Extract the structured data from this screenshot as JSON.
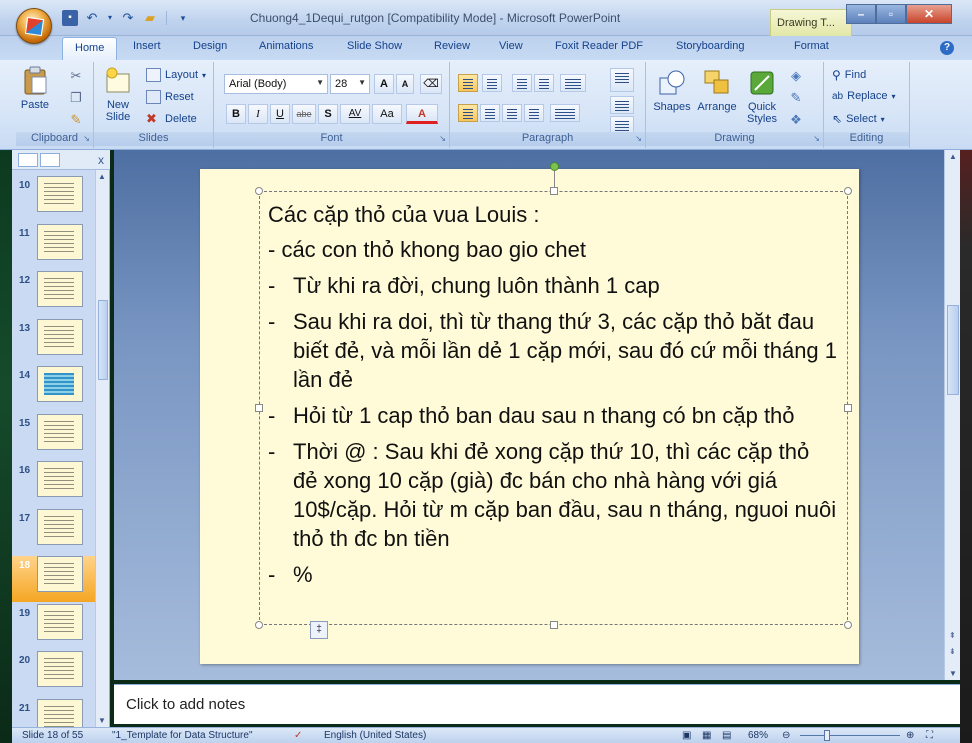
{
  "app": {
    "doc_title": "Chuong4_1Dequi_rutgon [Compatibility Mode] - Microsoft PowerPoint",
    "context_tab_title": "Drawing T..."
  },
  "tabs": [
    "Home",
    "Insert",
    "Design",
    "Animations",
    "Slide Show",
    "Review",
    "View",
    "Foxit Reader PDF",
    "Storyboarding",
    "Format"
  ],
  "ribbon": {
    "clipboard": {
      "paste": "Paste",
      "label": "Clipboard"
    },
    "slides": {
      "new_slide": "New",
      "new_slide2": "Slide",
      "layout": "Layout",
      "reset": "Reset",
      "delete": "Delete",
      "label": "Slides"
    },
    "font": {
      "font_name": "Arial (Body)",
      "font_size": "28",
      "grow": "A",
      "shrink": "A",
      "bold": "B",
      "italic": "I",
      "underline": "U",
      "strike": "abe",
      "shadow": "S",
      "spacing": "AV",
      "case": "Aa",
      "color": "A",
      "label": "Font"
    },
    "paragraph": {
      "label": "Paragraph"
    },
    "drawing": {
      "shapes": "Shapes",
      "arrange": "Arrange",
      "quick_styles": "Quick",
      "quick_styles2": "Styles",
      "label": "Drawing"
    },
    "editing": {
      "find": "Find",
      "replace": "Replace",
      "select": "Select",
      "label": "Editing"
    }
  },
  "slide_pane": {
    "thumbnails": [
      {
        "num": "10",
        "style": "text"
      },
      {
        "num": "11",
        "style": "text"
      },
      {
        "num": "12",
        "style": "text"
      },
      {
        "num": "13",
        "style": "text"
      },
      {
        "num": "14",
        "style": "blue"
      },
      {
        "num": "15",
        "style": "text"
      },
      {
        "num": "16",
        "style": "text"
      },
      {
        "num": "17",
        "style": "text"
      },
      {
        "num": "18",
        "style": "text",
        "selected": true
      },
      {
        "num": "19",
        "style": "text"
      },
      {
        "num": "20",
        "style": "text"
      },
      {
        "num": "21",
        "style": "text"
      }
    ]
  },
  "slide": {
    "line1": "Các cặp thỏ của vua Louis :",
    "line2": " - các con thỏ khong bao gio chet",
    "bullets": [
      "Từ khi ra đời, chung luôn thành 1 cap",
      "Sau khi ra doi, thì từ thang thứ 3, các cặp thỏ băt đau biết đẻ, và mỗi lần dẻ 1 cặp mới, sau đó cứ mỗi tháng 1 lần đẻ",
      "Hỏi từ 1 cap thỏ ban dau sau n thang có bn cặp thỏ",
      "Thời @ : Sau khi đẻ xong cặp thứ 10, thì các cặp thỏ đẻ  xong 10 cặp (già) đc bán cho nhà hàng với giá 10$/cặp. Hỏi từ m cặp ban đầu, sau n tháng, nguoi nuôi thỏ th đc bn tiền",
      "%"
    ],
    "bullet_char": "-"
  },
  "notes": {
    "placeholder": "Click to add notes"
  },
  "status": {
    "slide_of": "Slide 18 of 55",
    "theme": "\"1_Template for Data Structure\"",
    "language": "English (United States)",
    "zoom": "68%"
  }
}
